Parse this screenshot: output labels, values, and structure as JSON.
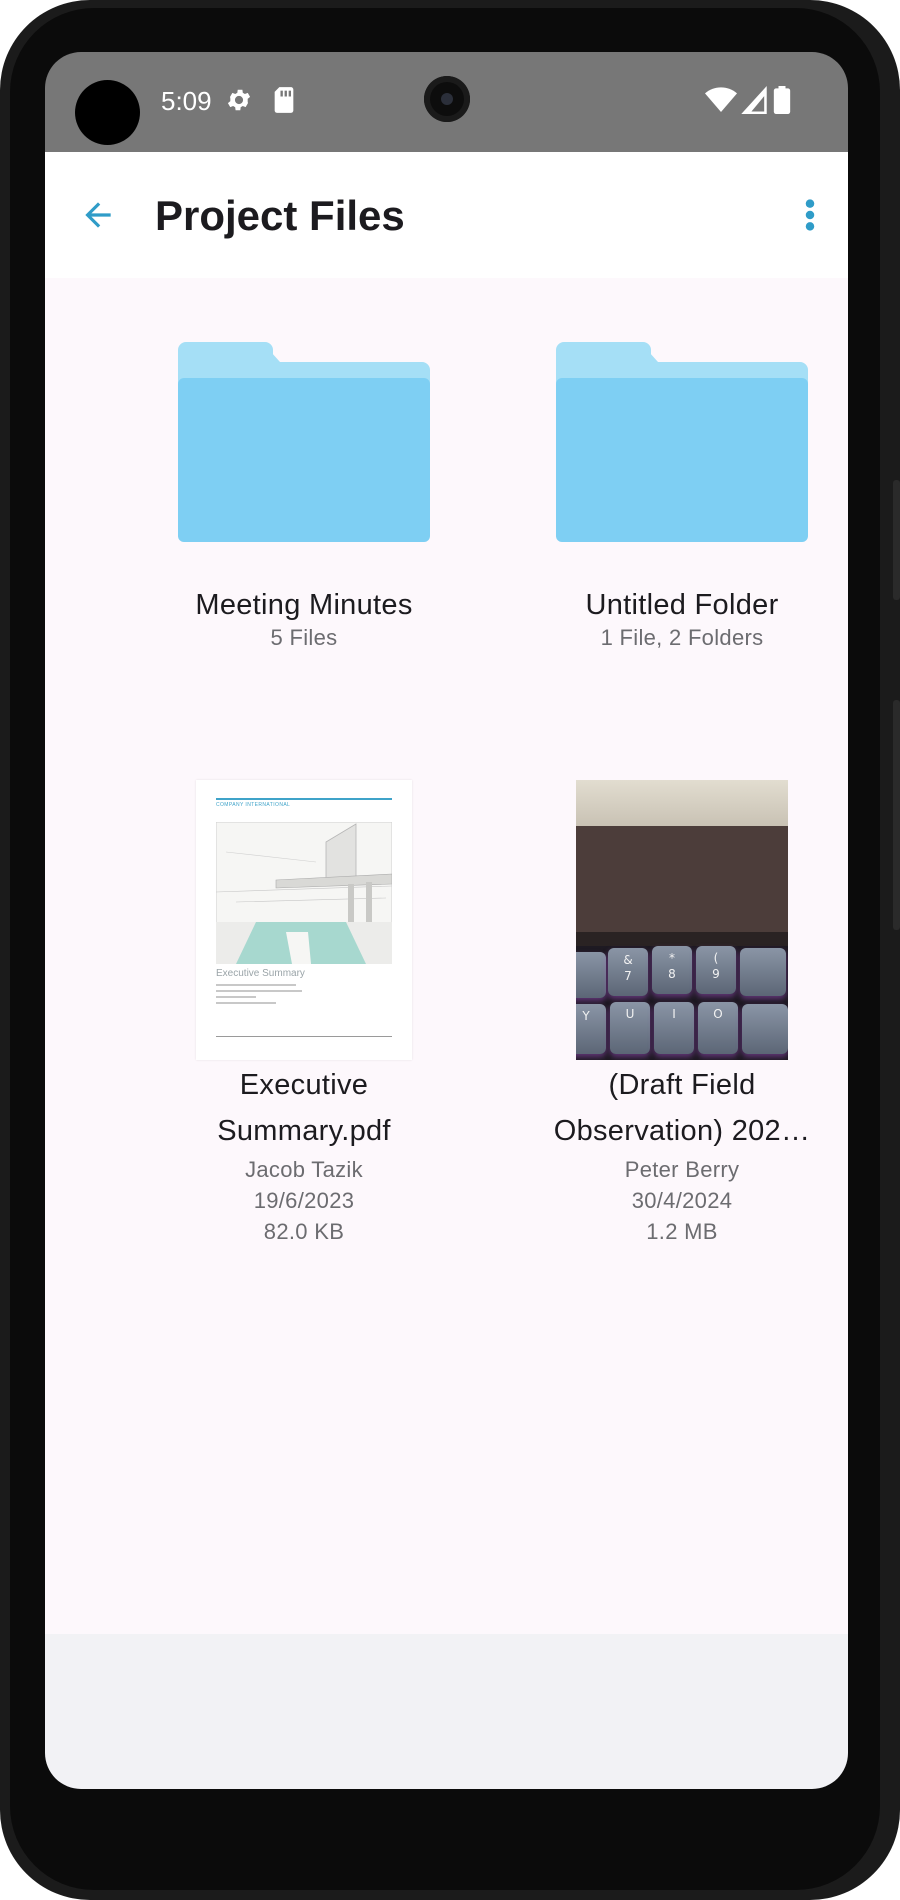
{
  "status_bar": {
    "time": "5:09",
    "icons": [
      "settings-icon",
      "sd-card-icon",
      "wifi-icon",
      "signal-icon",
      "battery-icon"
    ]
  },
  "app_bar": {
    "title": "Project Files",
    "back_icon": "arrow-back-icon",
    "menu_icon": "more-vert-icon"
  },
  "colors": {
    "accent": "#2f9cc8",
    "folder_light": "#a5dff6",
    "folder": "#7ecff3",
    "background": "#fdf8fc"
  },
  "items": [
    {
      "name": "Meeting Minutes",
      "meta1": "5 Files"
    },
    {
      "name": "Untitled Folder",
      "meta1": "1 File, 2 Folders"
    },
    {
      "name": "Executive",
      "name2": "Summary.pdf",
      "owner": "Jacob Tazik",
      "date": "19/6/2023",
      "size": "82.0 KB",
      "thumb": {
        "header": "COMPANY INTERNATIONAL",
        "heading": "Executive Summary"
      }
    },
    {
      "name": "(Draft Field",
      "name2": "Observation) 202…",
      "owner": "Peter Berry",
      "date": "30/4/2024",
      "size": "1.2 MB",
      "thumb": {
        "keys": [
          "&",
          "*",
          "(",
          "7",
          "8",
          "9",
          "Y",
          "U",
          "I",
          "O"
        ]
      }
    }
  ]
}
